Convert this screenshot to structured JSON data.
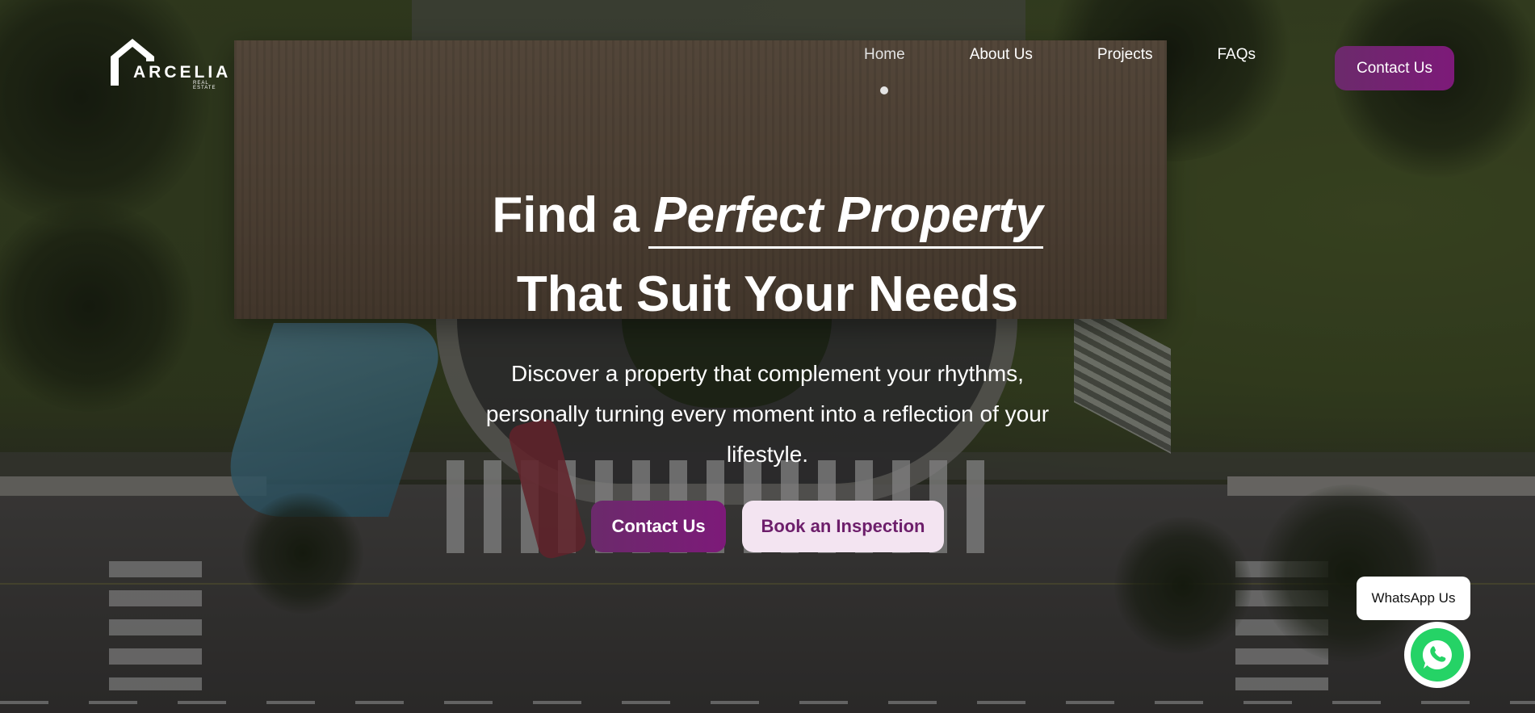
{
  "brand": {
    "name": "ARCELIA",
    "tagline": "REAL ESTATE"
  },
  "nav": {
    "items": [
      {
        "label": "Home",
        "active": true
      },
      {
        "label": "About Us"
      },
      {
        "label": "Projects"
      },
      {
        "label": "FAQs"
      }
    ],
    "cta": "Contact Us"
  },
  "hero": {
    "title_prefix": "Find a ",
    "title_emphasis": "Perfect Property",
    "title_line2": "That Suit Your Needs",
    "description": "Discover a property that complement your rhythms, personally turning every moment into a reflection of your lifestyle.",
    "primary_button": "Contact Us",
    "secondary_button": "Book an Inspection"
  },
  "whatsapp": {
    "label": "WhatsApp Us",
    "icon": "whatsapp-icon"
  },
  "colors": {
    "accent": "#7d1a79",
    "accent_light": "#f3e4f1",
    "whatsapp": "#25d366"
  }
}
